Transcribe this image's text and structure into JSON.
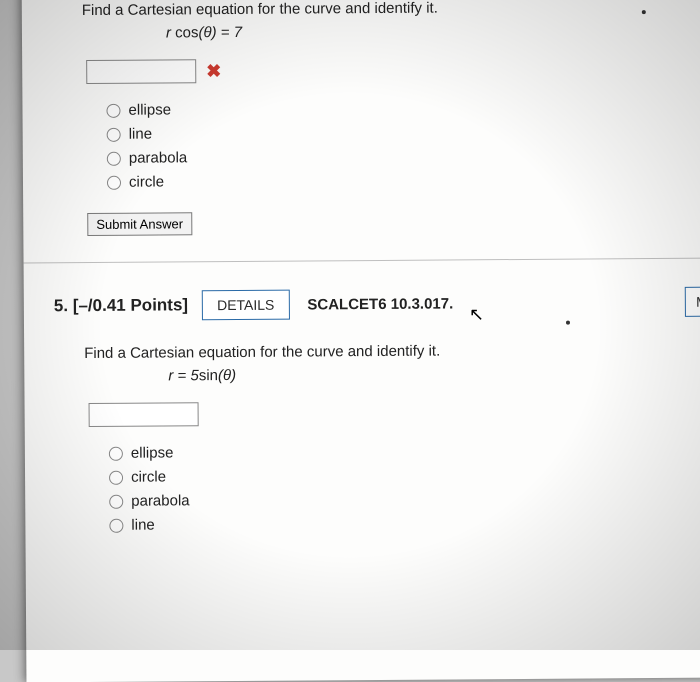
{
  "q4": {
    "prompt": "Find a Cartesian equation for the curve and identify it.",
    "formula_lhs": "r ",
    "formula_fn": "cos",
    "formula_arg": "(θ) = 7",
    "input_value": "",
    "mark": "✖",
    "options": [
      "ellipse",
      "line",
      "parabola",
      "circle"
    ],
    "submit_label": "Submit Answer"
  },
  "q5": {
    "number": "5.",
    "points": "[–/0.41 Points]",
    "details_label": "DETAILS",
    "reference": "SCALCET6 10.3.017.",
    "mynotes_label": "MY N",
    "prompt": "Find a Cartesian equation for the curve and identify it.",
    "formula_lhs": "r = 5",
    "formula_fn": "sin",
    "formula_arg": "(θ)",
    "input_value": "",
    "options": [
      "ellipse",
      "circle",
      "parabola",
      "line"
    ]
  }
}
